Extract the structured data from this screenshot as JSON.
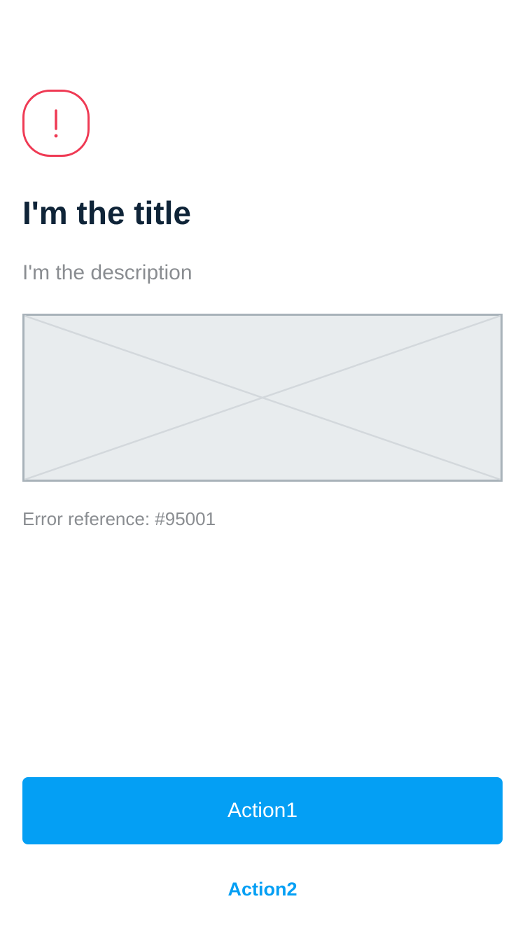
{
  "alert": {
    "icon": "alert-exclamation-icon",
    "color": "#ef3a54"
  },
  "content": {
    "title": "I'm the title",
    "description": "I'm the description",
    "image_placeholder_icon": "image-placeholder-icon",
    "error_reference": "Error reference: #95001"
  },
  "actions": {
    "primary_label": "Action1",
    "secondary_label": "Action2"
  },
  "colors": {
    "accent": "#049ff4",
    "title": "#0f2438",
    "muted_text": "#8a8d91",
    "placeholder_fill": "#e8ecee",
    "placeholder_border": "#a8b2b9"
  }
}
